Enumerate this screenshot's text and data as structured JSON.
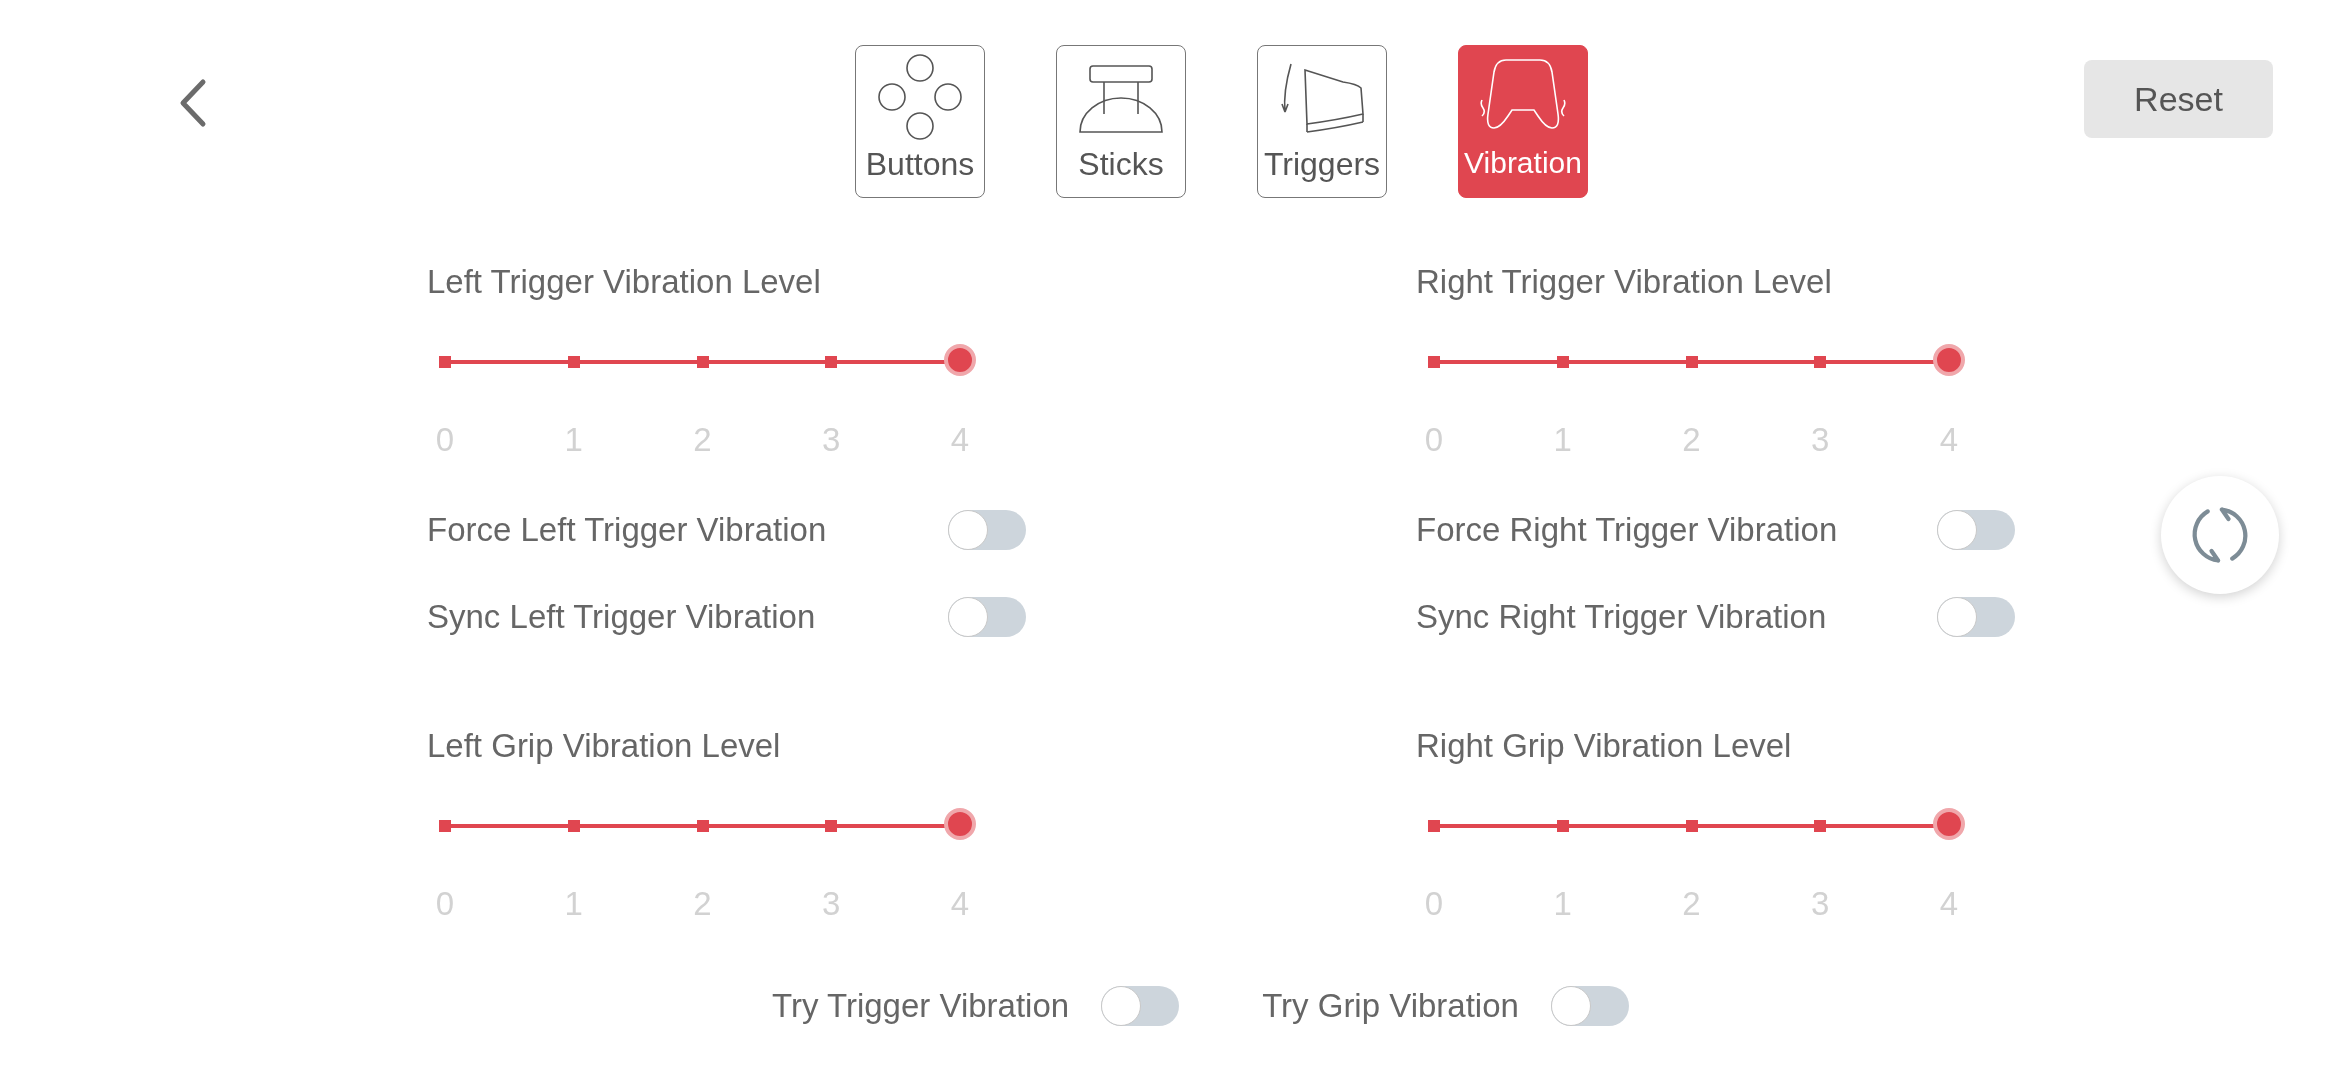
{
  "tabs": [
    {
      "kind": "buttons",
      "label": "Buttons",
      "selected": false
    },
    {
      "kind": "sticks",
      "label": "Sticks",
      "selected": false
    },
    {
      "kind": "triggers",
      "label": "Triggers",
      "selected": false
    },
    {
      "kind": "vibration",
      "label": "Vibration",
      "selected": true
    }
  ],
  "reset_button": "Reset",
  "columns": [
    {
      "items": [
        {
          "kind": "slider",
          "label": "Left Trigger Vibration Level",
          "level": 1,
          "ticks": [
            "0",
            "1",
            "2",
            "3",
            "4"
          ]
        },
        {
          "kind": "toggle",
          "label": "Force Left Trigger Vibration",
          "on": false
        },
        {
          "kind": "toggle",
          "label": "Sync Left Trigger Vibration",
          "on": false
        },
        {
          "kind": "slider",
          "label": "Left Grip Vibration Level",
          "level": 1,
          "ticks": [
            "0",
            "1",
            "2",
            "3",
            "4"
          ]
        }
      ]
    },
    {
      "items": [
        {
          "kind": "slider",
          "label": "Right Trigger Vibration Level",
          "level": 1,
          "ticks": [
            "0",
            "1",
            "2",
            "3",
            "4"
          ]
        },
        {
          "kind": "toggle",
          "label": "Force Right Trigger Vibration",
          "on": false
        },
        {
          "kind": "toggle",
          "label": "Sync Right Trigger Vibration",
          "on": false
        },
        {
          "kind": "slider",
          "label": "Right Grip Vibration Level",
          "level": 1,
          "ticks": [
            "0",
            "1",
            "2",
            "3",
            "4"
          ]
        }
      ]
    }
  ],
  "try_toggles": [
    {
      "label": "Try Trigger Vibration",
      "on": false
    },
    {
      "label": "Try Grip Vibration",
      "on": false
    }
  ]
}
